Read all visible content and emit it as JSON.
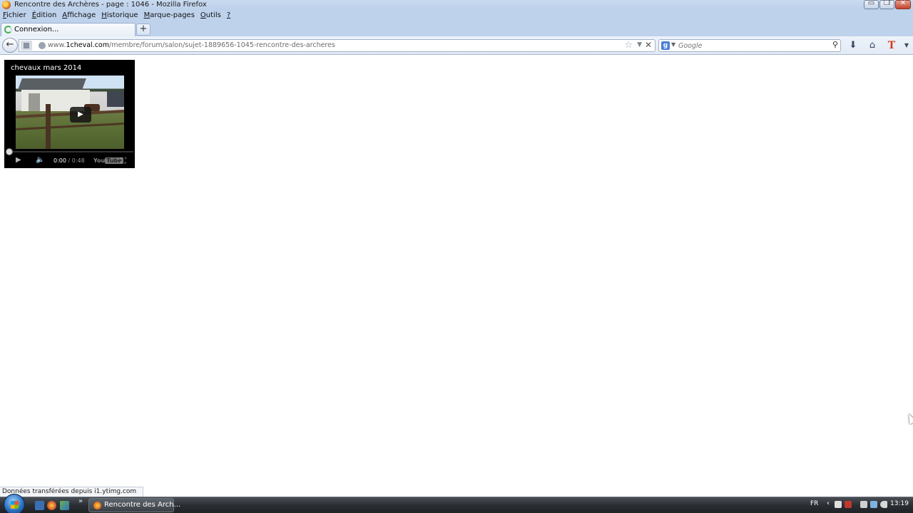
{
  "window": {
    "title": "Rencontre des Archères - page : 1046 - Mozilla Firefox",
    "buttons": {
      "minimize": "▭",
      "maximize": "❐",
      "close": "✕"
    }
  },
  "menubar": {
    "items": [
      {
        "label": "Fichier",
        "accel": "F",
        "rest": "ichier"
      },
      {
        "label": "Édition",
        "accel": "É",
        "rest": "dition"
      },
      {
        "label": "Affichage",
        "accel": "A",
        "rest": "ffichage"
      },
      {
        "label": "Historique",
        "accel": "H",
        "rest": "istorique"
      },
      {
        "label": "Marque-pages",
        "accel": "M",
        "rest": "arque-pages"
      },
      {
        "label": "Outils",
        "accel": "O",
        "rest": "utils"
      },
      {
        "label": "?",
        "accel": "?",
        "rest": ""
      }
    ]
  },
  "tabs": {
    "active_label": "Connexion...",
    "new_tab": "+"
  },
  "navbar": {
    "back": "←",
    "url_prefix": "www.",
    "url_host": "1cheval.com",
    "url_path": "/membre/forum/salon/sujet-1889656-1045-rencontre-des-archeres",
    "star": "☆",
    "dropdown": "▼",
    "stop": "✕",
    "search_engine": "g",
    "search_placeholder": "Google",
    "search_glass": "⚲",
    "download_icon": "⬇",
    "home_icon": "⌂",
    "t_icon": "T",
    "menu_icon": "▼"
  },
  "video": {
    "title": "chevaux mars 2014",
    "big_play": "▶",
    "play": "▶",
    "volume": "🔈",
    "time_current": "0:00",
    "time_separator": " / ",
    "time_duration": "0:48",
    "yt_you": "You",
    "yt_tube": "Tube",
    "fullscreen": "⛶",
    "progress": 0
  },
  "statusbar": {
    "text": "Données transférées depuis i1.ytimg.com"
  },
  "taskbar": {
    "more": "»",
    "task_label": "Rencontre des Arch...",
    "lang": "FR",
    "chevron": "‹",
    "clock": "13:19"
  },
  "colors": {
    "titlebar": "#bed2ec",
    "taskbar": "#2b2f34",
    "video_bg": "#000000"
  }
}
